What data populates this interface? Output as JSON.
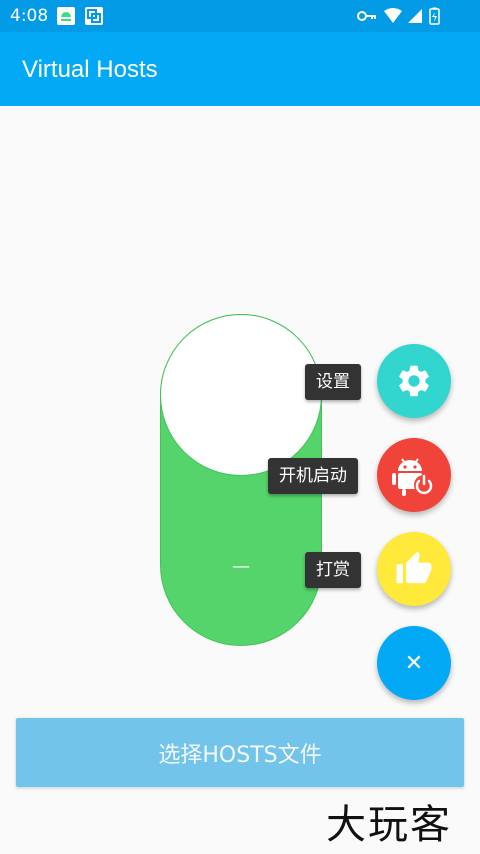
{
  "status_bar": {
    "time": "4:08",
    "icons": [
      "android-notification-icon",
      "screenshot-icon",
      "vpn-key-icon",
      "wifi-icon",
      "signal-icon",
      "battery-icon"
    ]
  },
  "app_bar": {
    "title": "Virtual Hosts"
  },
  "toggle": {
    "state_symbol": "—",
    "on": true,
    "color": "#54d46a"
  },
  "fab_menu": {
    "items": [
      {
        "label": "设置",
        "icon": "gear-icon",
        "color": "#33d6cf"
      },
      {
        "label": "开机启动",
        "icon": "android-power-icon",
        "color": "#f0443b"
      },
      {
        "label": "打赏",
        "icon": "thumbs-up-icon",
        "color": "#ffe93b"
      }
    ],
    "close": {
      "icon": "close-icon",
      "symbol": "✕",
      "color": "#03a9f4"
    }
  },
  "select_button": {
    "label": "选择HOSTS文件",
    "color": "#73c4ea"
  },
  "watermark": {
    "text": "大玩客"
  }
}
